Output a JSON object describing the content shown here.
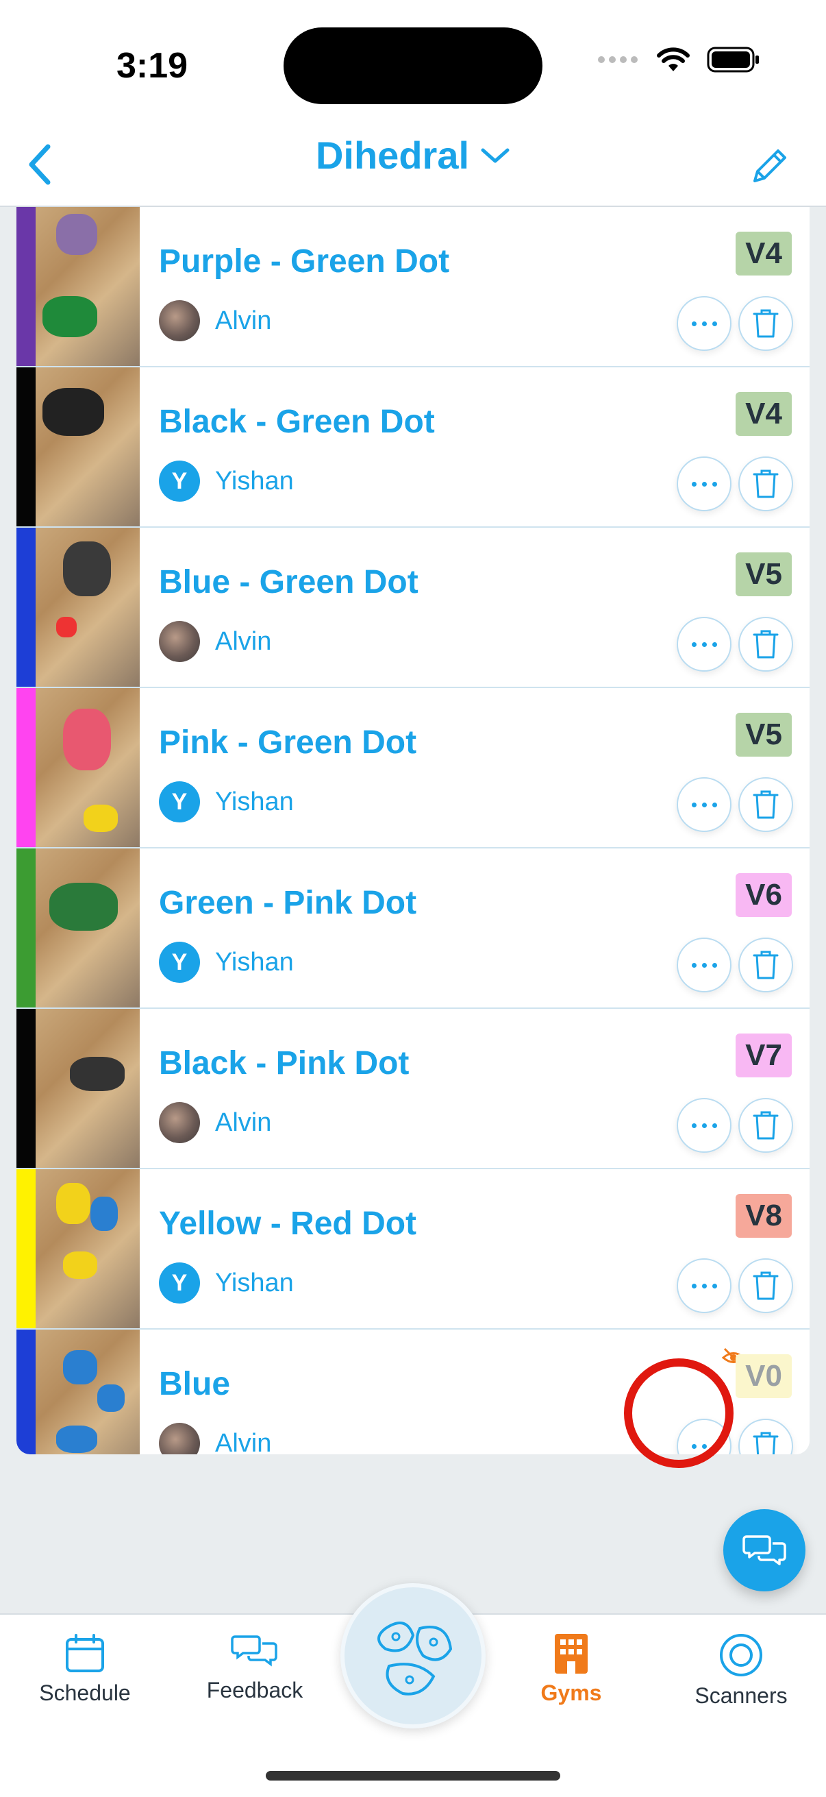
{
  "status_bar": {
    "time": "3:19"
  },
  "nav": {
    "title": "Dihedral"
  },
  "routes": [
    {
      "name": "Purple - Green Dot",
      "setter": "Alvin",
      "avatar": "photo",
      "grade": "V4",
      "strip_color": "#6a37a8",
      "grade_bg": "#b6d4a8"
    },
    {
      "name": "Black - Green Dot",
      "setter": "Yishan",
      "avatar": "letter",
      "avatar_letter": "Y",
      "grade": "V4",
      "strip_color": "#050505",
      "grade_bg": "#b6d4a8"
    },
    {
      "name": "Blue - Green Dot",
      "setter": "Alvin",
      "avatar": "photo",
      "grade": "V5",
      "strip_color": "#1d3ed6",
      "grade_bg": "#b6d4a8"
    },
    {
      "name": "Pink - Green Dot",
      "setter": "Yishan",
      "avatar": "letter",
      "avatar_letter": "Y",
      "grade": "V5",
      "strip_color": "#ff44f0",
      "grade_bg": "#b6d4a8"
    },
    {
      "name": "Green - Pink Dot",
      "setter": "Yishan",
      "avatar": "letter",
      "avatar_letter": "Y",
      "grade": "V6",
      "strip_color": "#3c9c32",
      "grade_bg": "#f8b8f3"
    },
    {
      "name": "Black - Pink Dot",
      "setter": "Alvin",
      "avatar": "photo",
      "grade": "V7",
      "strip_color": "#050505",
      "grade_bg": "#f8b8f3"
    },
    {
      "name": "Yellow - Red Dot",
      "setter": "Yishan",
      "avatar": "letter",
      "avatar_letter": "Y",
      "grade": "V8",
      "strip_color": "#fff200",
      "grade_bg": "#f6a89a"
    },
    {
      "name": "Blue",
      "setter": "Alvin",
      "avatar": "photo",
      "grade": "V0",
      "strip_color": "#1d3ed6",
      "grade_bg": "#fbf6cc",
      "hidden": true
    }
  ],
  "tabs": [
    {
      "label": "Schedule",
      "icon": "calendar-icon"
    },
    {
      "label": "Feedback",
      "icon": "chat-bubbles-icon"
    },
    {
      "label": "Gyms",
      "icon": "building-icon",
      "active": true
    },
    {
      "label": "Scanners",
      "icon": "target-icon"
    }
  ],
  "colors": {
    "accent": "#1aa3e8",
    "active_tab": "#f07a1a",
    "highlight": "#e0180f"
  }
}
